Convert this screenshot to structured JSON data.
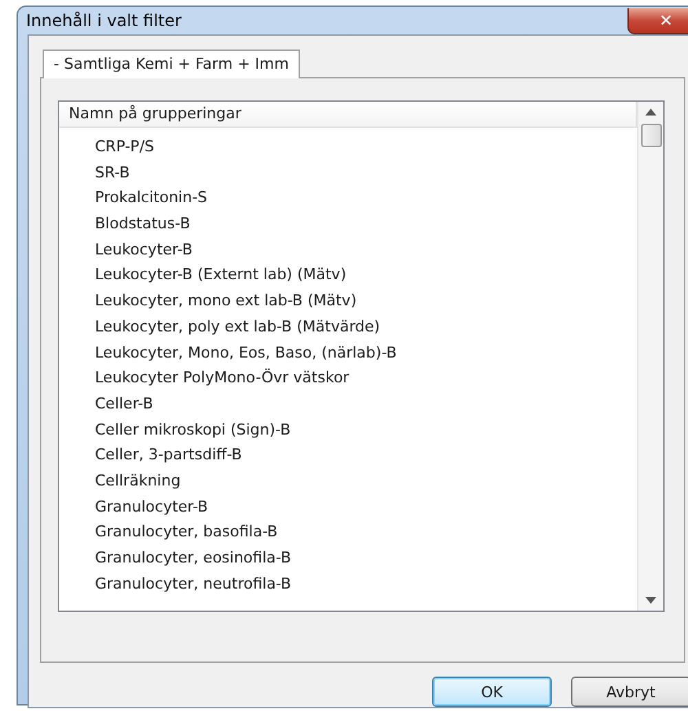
{
  "window": {
    "title": "Innehåll i valt filter",
    "close_label": "✕"
  },
  "tabs": [
    {
      "label": "- Samtliga Kemi + Farm +  Imm",
      "selected": true
    }
  ],
  "list": {
    "header": "Namn på grupperingar",
    "items": [
      "CRP-P/S",
      "SR-B",
      "Prokalcitonin-S",
      "Blodstatus-B",
      "Leukocyter-B",
      "Leukocyter-B (Externt lab) (Mätv)",
      "Leukocyter, mono ext lab-B (Mätv)",
      "Leukocyter, poly ext lab-B (Mätvärde)",
      "Leukocyter, Mono, Eos, Baso, (närlab)-B",
      "Leukocyter PolyMono-Övr vätskor",
      "Celler-B",
      "Celler mikroskopi (Sign)-B",
      "Celler, 3-partsdiff-B",
      "Cellräkning",
      "Granulocyter-B",
      "Granulocyter, basofila-B",
      "Granulocyter, eosinofila-B",
      "Granulocyter, neutrofila-B"
    ]
  },
  "buttons": [
    {
      "label": "OK",
      "default": true
    },
    {
      "label": "Avbryt",
      "default": false
    }
  ]
}
